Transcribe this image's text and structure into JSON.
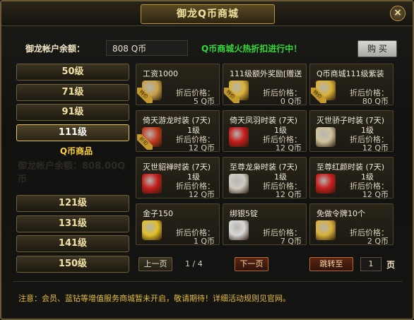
{
  "window": {
    "title": "御龙Q币商城",
    "close_label": "×"
  },
  "account": {
    "balance_label": "御龙帐户余额：",
    "balance_value": "808 Q币",
    "promo_text": "Q币商城火热折扣进行中！",
    "buy_label": "购 买"
  },
  "levels": [
    {
      "label": "50级",
      "active": false
    },
    {
      "label": "71级",
      "active": false
    },
    {
      "label": "91级",
      "active": false
    },
    {
      "label": "111级",
      "active": true
    },
    {
      "label": "121级",
      "active": false
    },
    {
      "label": "131级",
      "active": false
    },
    {
      "label": "141级",
      "active": false
    },
    {
      "label": "150级",
      "active": false
    }
  ],
  "category_tag": "Q币商品",
  "watermark_text": "御龙帐户余额：808.00Q币",
  "items": [
    {
      "name": "工资1000",
      "level": "",
      "price_label": "折后价格：",
      "price": "5 Q币",
      "icon": "coin-bag-icon",
      "color": "#c9a24b",
      "ribbon": "特价"
    },
    {
      "name": "111级额外奖励[赠送",
      "level": "",
      "price_label": "折后价格：",
      "price": "0 Q币",
      "icon": "gift-box-icon",
      "color": "#d9b23a",
      "ribbon": "特价"
    },
    {
      "name": "Q币商城111级紫装",
      "level": "",
      "price_label": "折后价格：",
      "price": "80 Q币",
      "icon": "gift-box-icon",
      "color": "#d9b23a",
      "ribbon": "特价"
    },
    {
      "name": "倚天游龙时装 (7天)",
      "level": "1级",
      "price_label": "折后价格：",
      "price": "12 Q币",
      "icon": "costume-icon",
      "color": "#c23b1f",
      "ribbon": "折扣"
    },
    {
      "name": "倚天凤羽时装 (7天)",
      "level": "1级",
      "price_label": "折后价格：",
      "price": "12 Q币",
      "icon": "costume-icon",
      "color": "#c61d1d",
      "ribbon": ""
    },
    {
      "name": "灭世骄子时装 (7天)",
      "level": "1级",
      "price_label": "折后价格：",
      "price": "12 Q币",
      "icon": "costume-icon",
      "color": "#d1c29e",
      "ribbon": ""
    },
    {
      "name": "灭世貂禅时装 (7天)",
      "level": "1级",
      "price_label": "折后价格：",
      "price": "12 Q币",
      "icon": "costume-icon",
      "color": "#c41f1f",
      "ribbon": ""
    },
    {
      "name": "至尊龙枭时装 (7天)",
      "level": "1级",
      "price_label": "折后价格：",
      "price": "12 Q币",
      "icon": "costume-icon",
      "color": "#cfcbc2",
      "ribbon": ""
    },
    {
      "name": "至尊红颜时装 (7天)",
      "level": "1级",
      "price_label": "折后价格：",
      "price": "12 Q币",
      "icon": "costume-icon",
      "color": "#c81f1f",
      "ribbon": ""
    },
    {
      "name": "金子150",
      "level": "",
      "price_label": "折后价格：",
      "price": "1 Q币",
      "icon": "gold-ingot-icon",
      "color": "#e2c12a",
      "ribbon": ""
    },
    {
      "name": "绑银5锭",
      "level": "",
      "price_label": "折后价格：",
      "price": "7 Q币",
      "icon": "silver-ingot-icon",
      "color": "#d8d8d8",
      "ribbon": ""
    },
    {
      "name": "免做令牌10个",
      "level": "",
      "price_label": "折后价格：",
      "price": "2 Q币",
      "icon": "gift-box-icon",
      "color": "#d9b23a",
      "ribbon": ""
    }
  ],
  "pager": {
    "prev_label": "上一页",
    "page_info": "1 / 4",
    "next_label": "下一页",
    "jump_label": "跳转至",
    "jump_value": "1",
    "page_unit": "页"
  },
  "notice": "注意：会员、蓝钻等增值服务商城暂未开启，敬请期待！详细活动规则见官网。"
}
